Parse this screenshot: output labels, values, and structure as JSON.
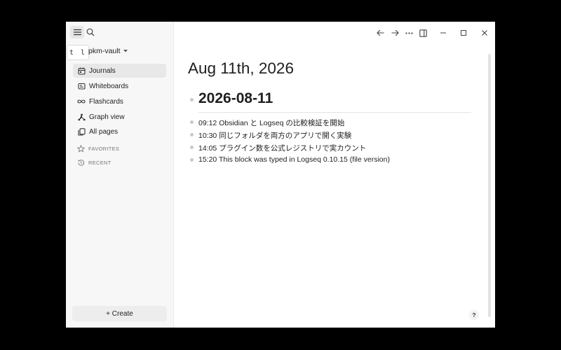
{
  "sidebar": {
    "tooltip": "t l",
    "graph_name": "pkm-vault",
    "nav": [
      {
        "label": "Journals",
        "icon": "calendar-icon"
      },
      {
        "label": "Whiteboards",
        "icon": "whiteboard-icon"
      },
      {
        "label": "Flashcards",
        "icon": "infinity-icon"
      },
      {
        "label": "Graph view",
        "icon": "hierarchy-icon"
      },
      {
        "label": "All pages",
        "icon": "pages-icon"
      }
    ],
    "sections": [
      {
        "label": "FAVORITES",
        "icon": "star-icon"
      },
      {
        "label": "RECENT",
        "icon": "history-icon"
      }
    ],
    "create_label": "+ Create"
  },
  "toolbar": {
    "icons": [
      "back-arrow-icon",
      "forward-arrow-icon",
      "more-icon",
      "right-sidebar-icon",
      "minimize-icon",
      "maximize-icon",
      "close-icon"
    ]
  },
  "page": {
    "title": "Aug 11th, 2026",
    "heading": "2026-08-11",
    "blocks": [
      "09:12 Obsidian と Logseq の比較検証を開始",
      "10:30 同じフォルダを両方のアプリで開く実験",
      "14:05 プラグイン数を公式レジストリで実カウント",
      "15:20 This block was typed in Logseq 0.10.15 (file version)"
    ]
  },
  "help_label": "?"
}
